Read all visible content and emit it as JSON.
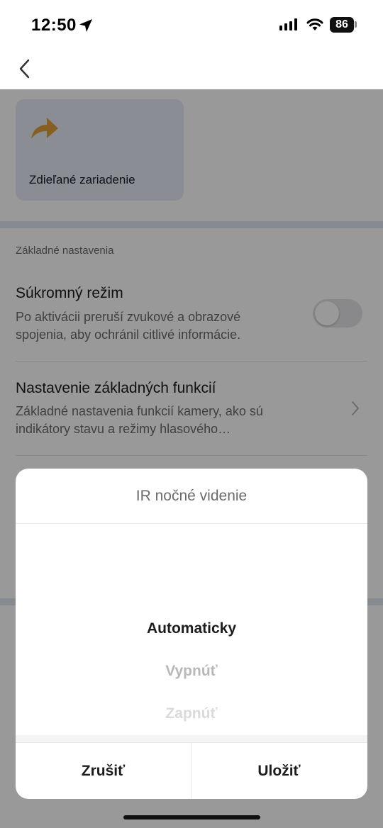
{
  "status_bar": {
    "time": "12:50",
    "battery": "86",
    "icons": [
      "location-arrow-icon",
      "signal-icon",
      "wifi-icon",
      "battery-icon"
    ]
  },
  "nav": {
    "back_icon": "chevron-left-icon"
  },
  "shared_device": {
    "icon": "share-arrow-icon",
    "label": "Zdieľané zariadenie",
    "icon_color": "#e0a03a"
  },
  "section": {
    "title": "Základné nastavenia"
  },
  "privacy": {
    "title": "Súkromný režim",
    "description": "Po aktivácii preruší zvukové a obrazové spojenia, aby ochránil citlivé informácie.",
    "toggle_on": false
  },
  "basic_functions": {
    "title": "Nastavenie základných funkcií",
    "description": "Základné nastavenia funkcií kamery, ako sú indikátory stavu a režimy hlasového…"
  },
  "picker": {
    "title": "IR nočné videnie",
    "options": [
      "Automaticky",
      "Vypnúť",
      "Zapnúť"
    ],
    "selected": "Automaticky",
    "cancel_label": "Zrušiť",
    "save_label": "Uložiť"
  }
}
